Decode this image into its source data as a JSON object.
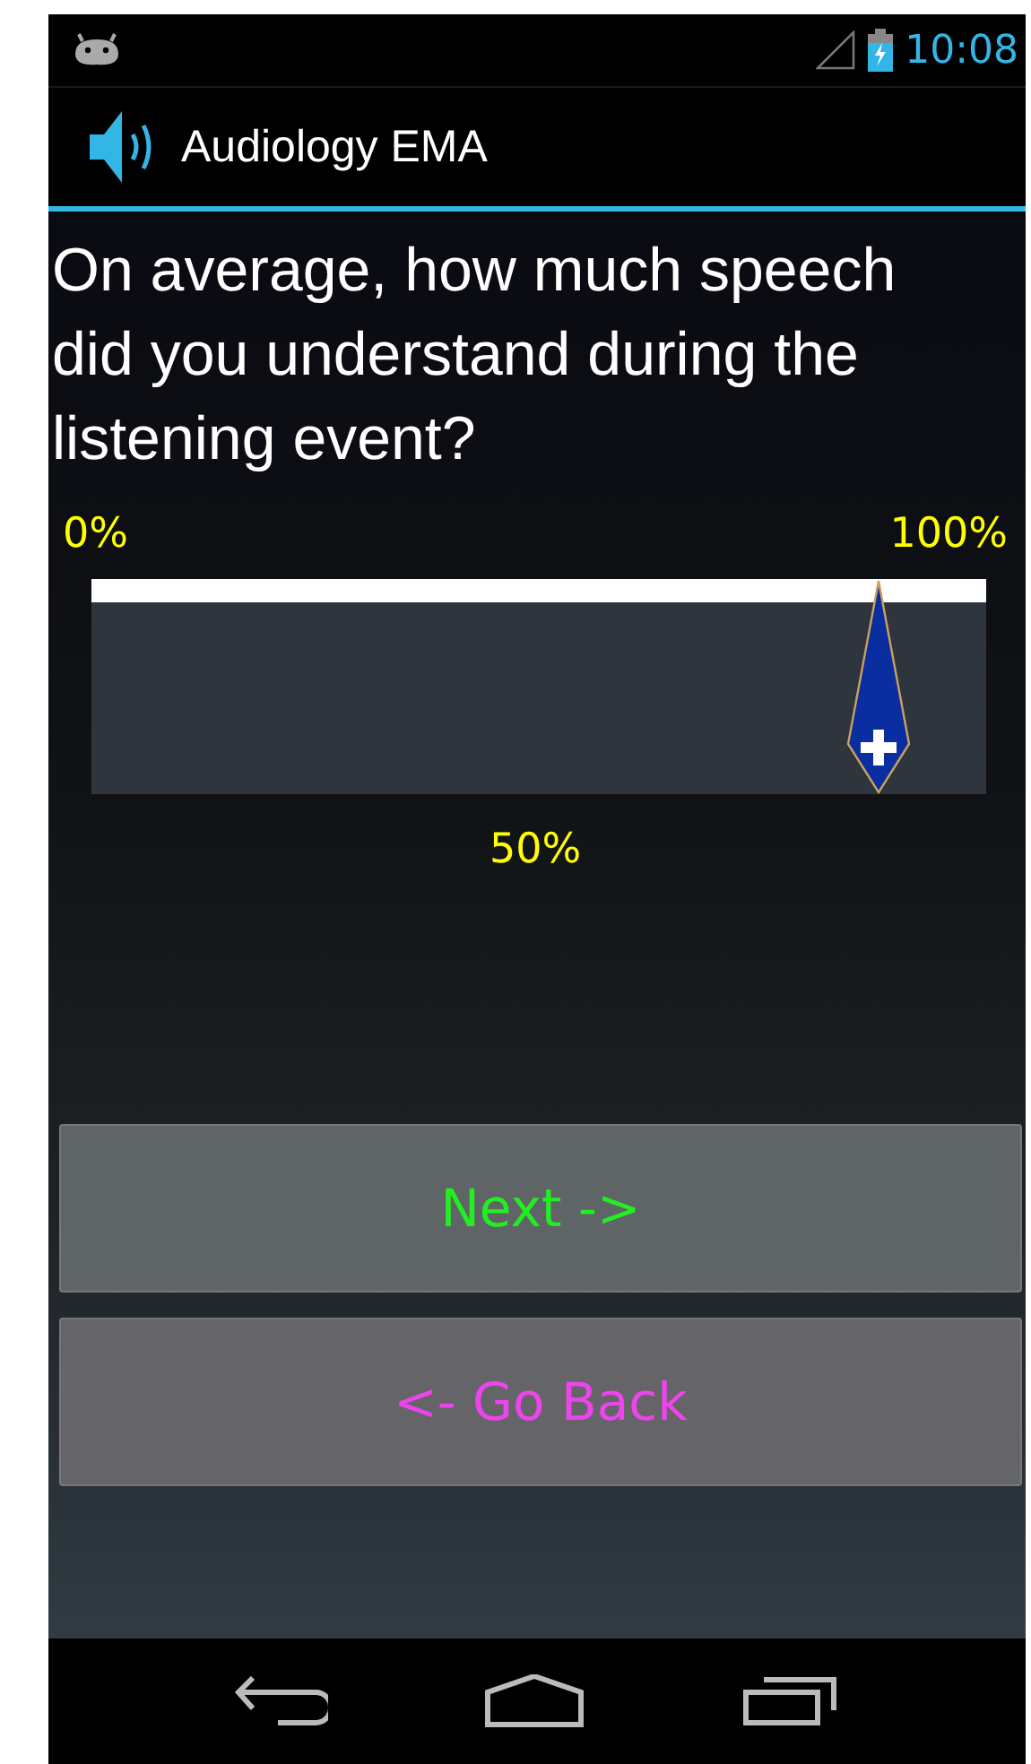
{
  "status_bar": {
    "time": "10:08"
  },
  "action_bar": {
    "title": "Audiology EMA"
  },
  "question": "On average, how much speech did you understand during the listening event?",
  "slider": {
    "min_label": "0%",
    "max_label": "100%",
    "level": 0.88,
    "reading": "50%"
  },
  "buttons": [
    {
      "label": "Next ->",
      "kind": "next"
    },
    {
      "label": "<- Go Back",
      "kind": "back"
    }
  ]
}
